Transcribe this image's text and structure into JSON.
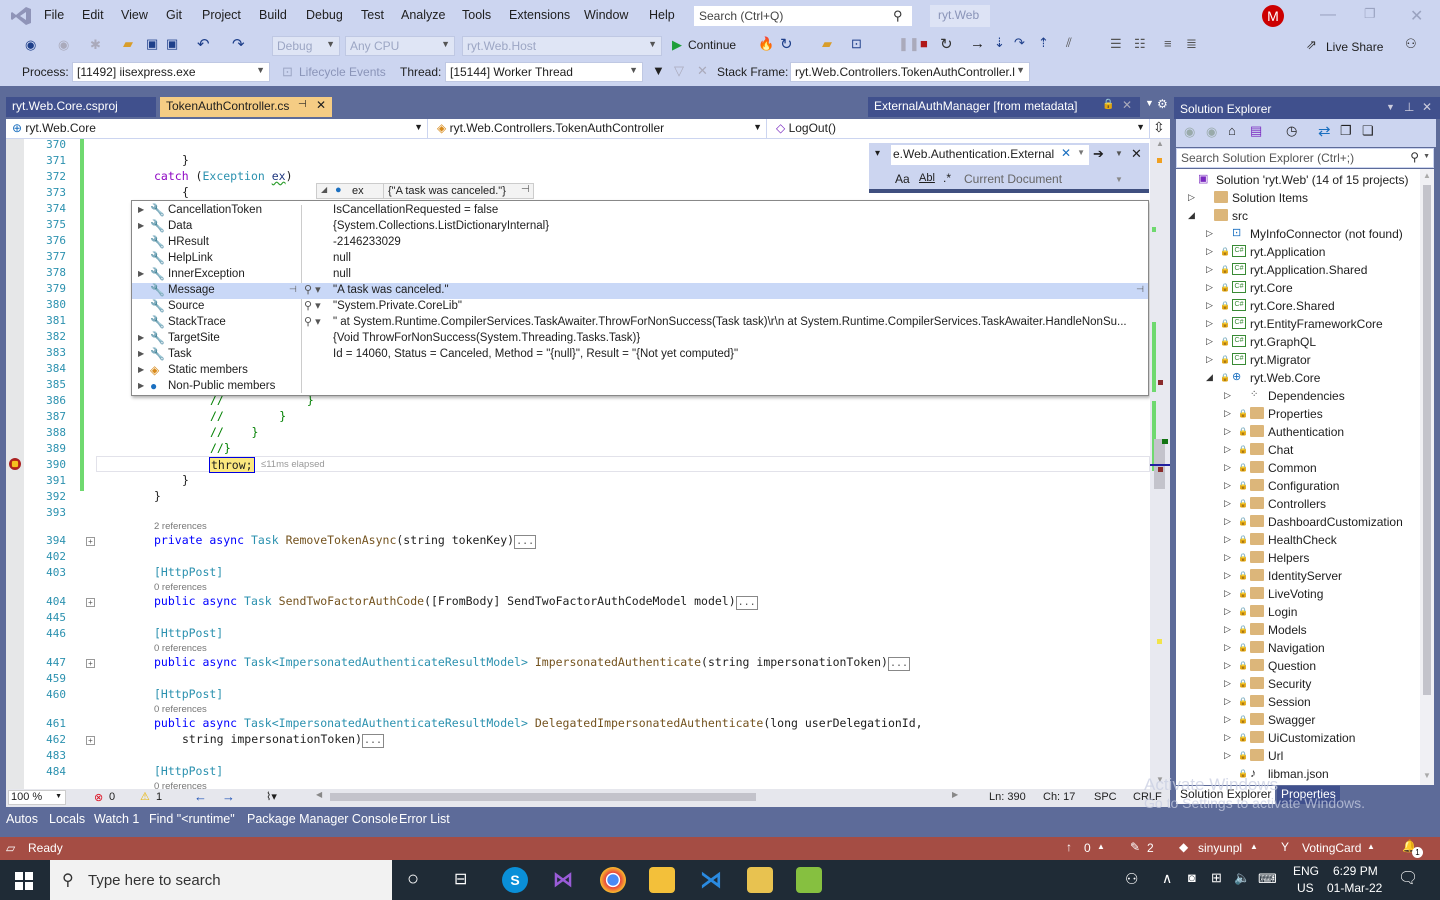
{
  "window": {
    "menu": [
      "File",
      "Edit",
      "View",
      "Git",
      "Project",
      "Build",
      "Debug",
      "Test",
      "Analyze",
      "Tools",
      "Extensions",
      "Window",
      "Help"
    ],
    "search_placeholder": "Search (Ctrl+Q)",
    "solution_name": "ryt.Web",
    "avatar_letter": "M",
    "controls": {
      "minimize": "—",
      "restore": "❐",
      "close": "✕"
    }
  },
  "toolbar": {
    "config": "Debug",
    "platform": "Any CPU",
    "startup_project": "ryt.Web.Host",
    "continue_label": "Continue",
    "live_share_label": "Live Share",
    "process_label": "Process:",
    "process_value": "[11492] iisexpress.exe",
    "lifecycle_label": "Lifecycle Events",
    "thread_label": "Thread:",
    "thread_value": "[15144] Worker Thread",
    "stack_frame_label": "Stack Frame:",
    "stack_frame_value": "ryt.Web.Controllers.TokenAuthController.l"
  },
  "tabs": {
    "csproj": "ryt.Web.Core.csproj",
    "active": "TokenAuthController.cs",
    "metadata": "ExternalAuthManager [from metadata]"
  },
  "navbar": {
    "project": "ryt.Web.Core",
    "type": "ryt.Web.Controllers.TokenAuthController",
    "member": "LogOut()"
  },
  "find": {
    "query": "e.Web.Authentication.External",
    "scope": "Current Document",
    "opt_case": "Aa",
    "opt_word": "Abl",
    "opt_regex": ".*"
  },
  "editor": {
    "lines": [
      {
        "n": "370",
        "code": ""
      },
      {
        "n": "371",
        "code": "}"
      },
      {
        "n": "372",
        "code": "catch (Exception ex)"
      },
      {
        "n": "373",
        "code": "{"
      },
      {
        "n": "374"
      },
      {
        "n": "375"
      },
      {
        "n": "376"
      },
      {
        "n": "377"
      },
      {
        "n": "378"
      },
      {
        "n": "379"
      },
      {
        "n": "380"
      },
      {
        "n": "381"
      },
      {
        "n": "382"
      },
      {
        "n": "383"
      },
      {
        "n": "384"
      },
      {
        "n": "385"
      },
      {
        "n": "386",
        "code": "//            }"
      },
      {
        "n": "387",
        "code": "//        }"
      },
      {
        "n": "388",
        "code": "//    }"
      },
      {
        "n": "389",
        "code": "//}"
      },
      {
        "n": "390",
        "code": "throw;"
      },
      {
        "n": "391",
        "code": "}"
      },
      {
        "n": "392",
        "code": "}"
      },
      {
        "n": "393",
        "code": ""
      }
    ],
    "elapsed": "≤11ms elapsed",
    "methods": [
      {
        "n": "394",
        "refs": "2 references",
        "attr": "",
        "sig_kw": "private async",
        "sig_type": "Task",
        "sig_name": "RemoveTokenAsync",
        "sig_params": "(string tokenKey)"
      },
      {
        "n": "402"
      },
      {
        "n": "403",
        "attr": "[HttpPost]",
        "refs": "0 references"
      },
      {
        "n": "404",
        "sig_kw": "public async",
        "sig_type": "Task",
        "sig_name": "SendTwoFactorAuthCode",
        "sig_params": "([FromBody] SendTwoFactorAuthCodeModel model)"
      },
      {
        "n": "445"
      },
      {
        "n": "446",
        "attr": "[HttpPost]",
        "refs": "0 references"
      },
      {
        "n": "447",
        "sig_kw": "public async",
        "sig_type": "Task<ImpersonatedAuthenticateResultModel>",
        "sig_name": "ImpersonatedAuthenticate",
        "sig_params": "(string impersonationToken)"
      },
      {
        "n": "459"
      },
      {
        "n": "460",
        "attr": "[HttpPost]",
        "refs": "0 references"
      },
      {
        "n": "461",
        "sig_kw": "public async",
        "sig_type": "Task<ImpersonatedAuthenticateResultModel>",
        "sig_name": "DelegatedImpersonatedAuthenticate",
        "sig_params": "(long userDelegationId,"
      },
      {
        "n": "462",
        "sig_params": "string impersonationToken)"
      },
      {
        "n": "483"
      },
      {
        "n": "484",
        "attr": "[HttpPost]",
        "refs": "0 references"
      }
    ]
  },
  "datatip": {
    "var_name": "ex",
    "var_value": "{\"A task was canceled.\"}",
    "rows": [
      {
        "name": "CancellationToken",
        "value": "IsCancellationRequested = false",
        "expandable": true
      },
      {
        "name": "Data",
        "value": "{System.Collections.ListDictionaryInternal}",
        "expandable": true
      },
      {
        "name": "HResult",
        "value": "-2146233029",
        "expandable": false
      },
      {
        "name": "HelpLink",
        "value": "null",
        "expandable": false
      },
      {
        "name": "InnerException",
        "value": "null",
        "expandable": true
      },
      {
        "name": "Message",
        "value": "\"A task was canceled.\"",
        "expandable": false,
        "selected": true,
        "viewer": true
      },
      {
        "name": "Source",
        "value": "\"System.Private.CoreLib\"",
        "expandable": false,
        "viewer": true
      },
      {
        "name": "StackTrace",
        "value": "\"   at System.Runtime.CompilerServices.TaskAwaiter.ThrowForNonSuccess(Task task)\\r\\n   at System.Runtime.CompilerServices.TaskAwaiter.HandleNonSu...",
        "expandable": false,
        "viewer": true
      },
      {
        "name": "TargetSite",
        "value": "{Void ThrowForNonSuccess(System.Threading.Tasks.Task)}",
        "expandable": true
      },
      {
        "name": "Task",
        "value": "Id = 14060, Status = Canceled, Method = \"{null}\", Result = \"{Not yet computed}\"",
        "expandable": true
      },
      {
        "name": "Static members",
        "value": "",
        "expandable": true,
        "icon": "static"
      },
      {
        "name": "Non-Public members",
        "value": "",
        "expandable": true,
        "icon": "nonpublic"
      }
    ]
  },
  "editor_status": {
    "zoom": "100 %",
    "errors": "0",
    "warnings": "1",
    "line": "Ln: 390",
    "col": "Ch: 17",
    "spc": "SPC",
    "eol": "CRLF"
  },
  "solution_explorer": {
    "title": "Solution Explorer",
    "search_placeholder": "Search Solution Explorer (Ctrl+;)",
    "items": [
      {
        "label": "Solution 'ryt.Web' (14 of 15 projects)",
        "depth": 0,
        "kind": "solution",
        "exp": ""
      },
      {
        "label": "Solution Items",
        "depth": 1,
        "kind": "folder",
        "exp": "▷"
      },
      {
        "label": "src",
        "depth": 1,
        "kind": "folder-open",
        "exp": "◢"
      },
      {
        "label": "MyInfoConnector (not found)",
        "depth": 2,
        "kind": "missing",
        "exp": "▷"
      },
      {
        "label": "ryt.Application",
        "depth": 2,
        "kind": "cs",
        "exp": "▷",
        "lock": true
      },
      {
        "label": "ryt.Application.Shared",
        "depth": 2,
        "kind": "cs",
        "exp": "▷",
        "lock": true
      },
      {
        "label": "ryt.Core",
        "depth": 2,
        "kind": "cs",
        "exp": "▷",
        "lock": true
      },
      {
        "label": "ryt.Core.Shared",
        "depth": 2,
        "kind": "cs",
        "exp": "▷",
        "lock": true
      },
      {
        "label": "ryt.EntityFrameworkCore",
        "depth": 2,
        "kind": "cs",
        "exp": "▷",
        "lock": true
      },
      {
        "label": "ryt.GraphQL",
        "depth": 2,
        "kind": "cs",
        "exp": "▷",
        "lock": true
      },
      {
        "label": "ryt.Migrator",
        "depth": 2,
        "kind": "cs",
        "exp": "▷",
        "lock": true
      },
      {
        "label": "ryt.Web.Core",
        "depth": 2,
        "kind": "web",
        "exp": "◢",
        "lock": true
      },
      {
        "label": "Dependencies",
        "depth": 3,
        "kind": "deps",
        "exp": "▷"
      },
      {
        "label": "Properties",
        "depth": 3,
        "kind": "folder",
        "exp": "▷",
        "lock": true
      },
      {
        "label": "Authentication",
        "depth": 3,
        "kind": "folder",
        "exp": "▷",
        "lock": true
      },
      {
        "label": "Chat",
        "depth": 3,
        "kind": "folder",
        "exp": "▷",
        "lock": true
      },
      {
        "label": "Common",
        "depth": 3,
        "kind": "folder",
        "exp": "▷",
        "lock": true
      },
      {
        "label": "Configuration",
        "depth": 3,
        "kind": "folder",
        "exp": "▷",
        "lock": true
      },
      {
        "label": "Controllers",
        "depth": 3,
        "kind": "folder",
        "exp": "▷",
        "lock": true
      },
      {
        "label": "DashboardCustomization",
        "depth": 3,
        "kind": "folder",
        "exp": "▷",
        "lock": true
      },
      {
        "label": "HealthCheck",
        "depth": 3,
        "kind": "folder",
        "exp": "▷",
        "lock": true
      },
      {
        "label": "Helpers",
        "depth": 3,
        "kind": "folder",
        "exp": "▷",
        "lock": true
      },
      {
        "label": "IdentityServer",
        "depth": 3,
        "kind": "folder",
        "exp": "▷",
        "lock": true
      },
      {
        "label": "LiveVoting",
        "depth": 3,
        "kind": "folder",
        "exp": "▷",
        "lock": true
      },
      {
        "label": "Login",
        "depth": 3,
        "kind": "folder",
        "exp": "▷",
        "lock": true
      },
      {
        "label": "Models",
        "depth": 3,
        "kind": "folder",
        "exp": "▷",
        "lock": true
      },
      {
        "label": "Navigation",
        "depth": 3,
        "kind": "folder",
        "exp": "▷",
        "lock": true
      },
      {
        "label": "Question",
        "depth": 3,
        "kind": "folder",
        "exp": "▷",
        "lock": true
      },
      {
        "label": "Security",
        "depth": 3,
        "kind": "folder",
        "exp": "▷",
        "lock": true
      },
      {
        "label": "Session",
        "depth": 3,
        "kind": "folder",
        "exp": "▷",
        "lock": true
      },
      {
        "label": "Swagger",
        "depth": 3,
        "kind": "folder",
        "exp": "▷",
        "lock": true
      },
      {
        "label": "UiCustomization",
        "depth": 3,
        "kind": "folder",
        "exp": "▷",
        "lock": true
      },
      {
        "label": "Url",
        "depth": 3,
        "kind": "folder",
        "exp": "▷",
        "lock": true
      },
      {
        "label": "libman.json",
        "depth": 3,
        "kind": "json",
        "exp": "",
        "lock": true
      }
    ],
    "tabs": [
      "Solution Explorer",
      "Properties"
    ]
  },
  "tool_tabs": [
    "Autos",
    "Locals",
    "Watch 1",
    "Find \"<runtime\"",
    "Package Manager Console",
    "Error List"
  ],
  "statusbar": {
    "ready": "Ready",
    "push": "0",
    "changes": "2",
    "repo": "sinyunpl",
    "branch": "VotingCard",
    "notifications": "1"
  },
  "watermark": {
    "line1": "Activate Windows",
    "line2": "Go to Settings to activate Windows."
  },
  "taskbar": {
    "search_placeholder": "Type here to search",
    "lang1": "ENG",
    "lang2": "US",
    "time": "6:29 PM",
    "date": "01-Mar-22"
  }
}
